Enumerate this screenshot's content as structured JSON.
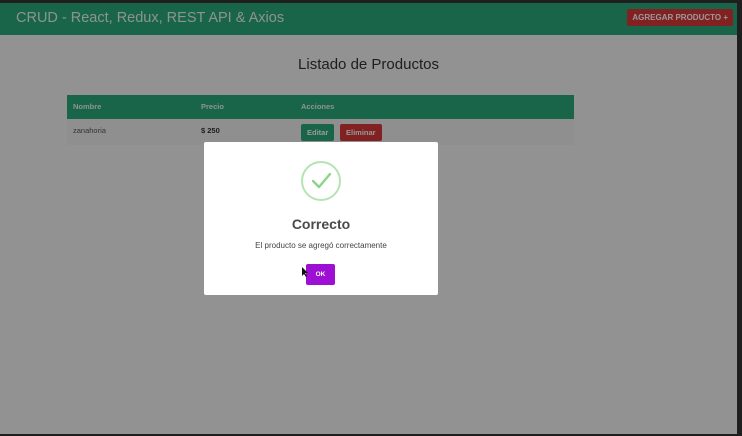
{
  "navbar": {
    "brand": "CRUD - React, Redux, REST API & Axios",
    "add_button": "AGREGAR PRODUCTO +"
  },
  "page": {
    "title": "Listado de Productos"
  },
  "table": {
    "headers": [
      "Nombre",
      "Precio",
      "Acciones"
    ],
    "rows": [
      {
        "name": "zanahoria",
        "price": "$ 250",
        "edit": "Editar",
        "delete": "Eliminar"
      }
    ]
  },
  "modal": {
    "icon": "check-icon",
    "title": "Correcto",
    "message": "El producto se agregó correctamente",
    "ok": "OK"
  },
  "colors": {
    "navbar": "#2aa87b",
    "danger": "#d7373a",
    "ok_button": "#9e0fd4",
    "success_ring": "#b6e3b4"
  }
}
